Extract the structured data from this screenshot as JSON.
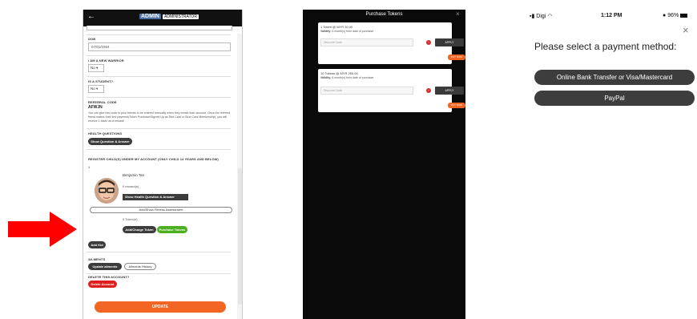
{
  "panel_a": {
    "header": {
      "back": "←",
      "logo": "ADMIN",
      "logo_tag": "ADMINISTRATOR"
    },
    "dob": {
      "label": "DOB",
      "value": "07/01/1964"
    },
    "new_warrior": {
      "label": "I AM A NEW WARRIOR",
      "value": "No"
    },
    "student": {
      "label": "IS A STUDENT?",
      "value": "No"
    },
    "referral": {
      "label": "REFERRAL CODE",
      "code": "AFWJN",
      "text": "You can give this code to your friends to be entered manually when they create their account. Once the referred friend makes their first payment(Token Purchase/Signed Up as Red Card or Blue Card Membership), you will receive 1 token as a reward!"
    },
    "health": {
      "label": "HEALTH QUESTIONS",
      "button": "Show Question & Answer"
    },
    "children": {
      "label": "REGISTER CHILD(S) UNDER MY ACCOUNT (ONLY CHILD 14 YEARS AND BELOW)",
      "count": "1"
    },
    "child": {
      "name": "Benjamin Tan",
      "rewards": "0 reward(s)",
      "health_button": "Show Health Question & Answer",
      "fitness_button": "Add/Show Fitness Assessment",
      "tokens": "0 Token(s)",
      "add_token": "Add/Charge Token",
      "purchase": "Purchase Tokens"
    },
    "add_kid": "Add Kid",
    "ailments": {
      "label": "AILMENTS",
      "update": "Update ailments",
      "history": "Ailments History"
    },
    "delete": {
      "label": "DELETE THIS ACCOUNT?",
      "button": "Delete Account"
    },
    "update": "UPDATE"
  },
  "panel_b": {
    "title": "Purchase Tokens",
    "close": "×",
    "cards": [
      {
        "title": "1 Token @ MYR 30.00",
        "validity_label": "Validity:",
        "validity": "6 month(s) from date of purchase",
        "placeholder": "Discount Code",
        "apply": "APPLY",
        "buy": "BUY NOW"
      },
      {
        "title": "10 Tokens @ MYR 250.00",
        "validity_label": "Validity:",
        "validity": "6 month(s) from date of purchase",
        "placeholder": "Discount Code",
        "apply": "APPLY",
        "buy": "BUY NOW"
      }
    ]
  },
  "panel_c": {
    "status": {
      "carrier": "Digi",
      "time": "1:12 PM",
      "battery": "96%"
    },
    "close": "×",
    "message": "Please select a payment method:",
    "options": [
      "Online Bank Transfer or Visa/Mastercard",
      "PayPal"
    ]
  },
  "colors": {
    "accent": "#f26522",
    "green": "#4caf1f",
    "red": "#e01f1f",
    "dark": "#3c3c3c",
    "arrow": "#ff0000"
  }
}
